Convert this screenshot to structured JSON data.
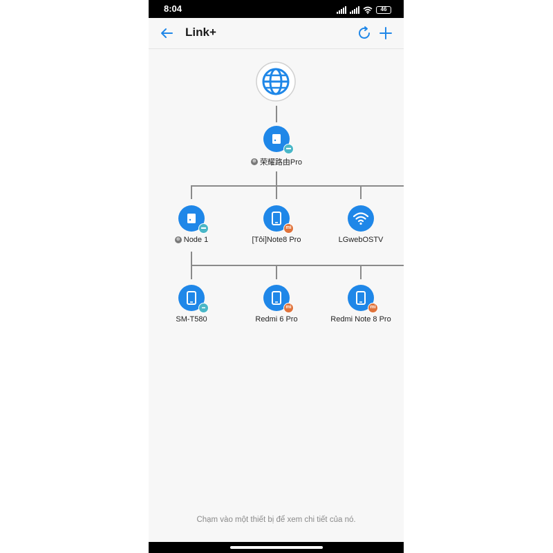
{
  "status_bar": {
    "time": "8:04",
    "battery": "46"
  },
  "app_bar": {
    "title": "Link+"
  },
  "icons": {
    "back": "arrow-left-icon",
    "refresh": "refresh-icon",
    "add": "plus-icon",
    "internet": "globe-icon",
    "router": "router-icon",
    "phone": "phone-icon",
    "wifi": "wifi-icon"
  },
  "colors": {
    "accent": "#1f87e8",
    "badge_honor": "#4ab7c7",
    "badge_mi": "#e0733b",
    "line": "#8a8a8a"
  },
  "topology": {
    "router": {
      "name": "荣耀路由Pro"
    },
    "level1": [
      {
        "name": "Node 1",
        "badge": ""
      },
      {
        "name": "[Tôi]Note8 Pro",
        "badge": "mi"
      },
      {
        "name": "LGwebOSTV",
        "badge": ""
      }
    ],
    "level2": [
      {
        "name": "SM-T580",
        "badge": ""
      },
      {
        "name": "Redmi 6 Pro",
        "badge": "mi"
      },
      {
        "name": "Redmi Note 8 Pro",
        "badge": "mi"
      }
    ]
  },
  "hint": "Chạm vào một thiết bị để xem chi tiết của nó."
}
